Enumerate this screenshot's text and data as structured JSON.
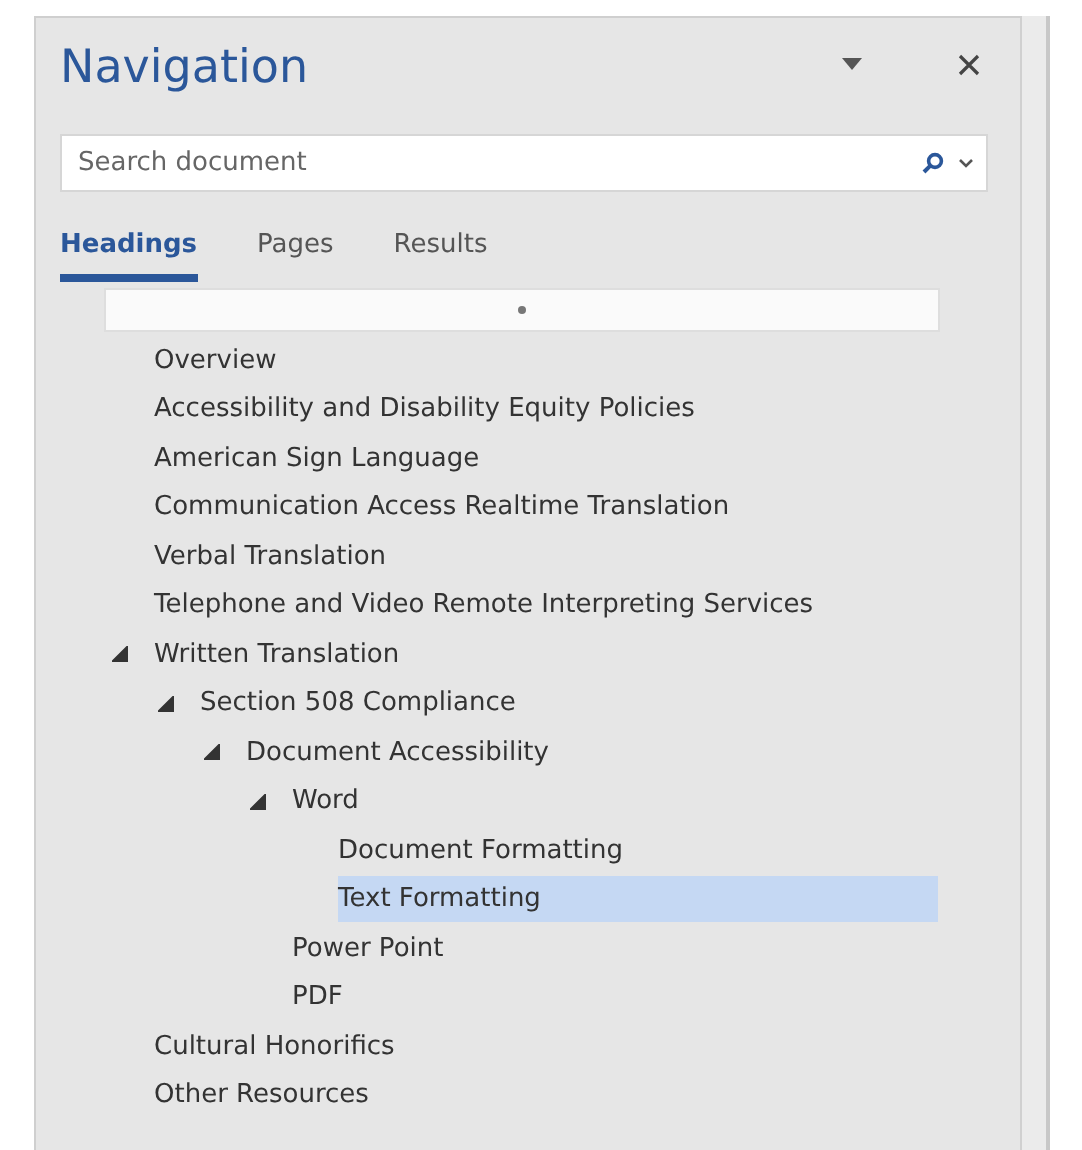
{
  "pane": {
    "title": "Navigation"
  },
  "search": {
    "placeholder": "Search document"
  },
  "tabs": [
    {
      "label": "Headings",
      "selected": true
    },
    {
      "label": "Pages",
      "selected": false
    },
    {
      "label": "Results",
      "selected": false
    }
  ],
  "tree": [
    {
      "label": "Overview",
      "selected": false
    },
    {
      "label": "Accessibility and Disability Equity Policies",
      "selected": false
    },
    {
      "label": "American Sign Language",
      "selected": false
    },
    {
      "label": "Communication Access Realtime Translation",
      "selected": false
    },
    {
      "label": "Verbal Translation",
      "selected": false
    },
    {
      "label": "Telephone and Video Remote Interpreting Services",
      "selected": false
    },
    {
      "label": "Written Translation",
      "selected": false,
      "expanded": true,
      "children": [
        {
          "label": "Section 508 Compliance",
          "selected": false,
          "expanded": true,
          "children": [
            {
              "label": "Document Accessibility",
              "selected": false,
              "expanded": true,
              "children": [
                {
                  "label": "Word",
                  "selected": false,
                  "expanded": true,
                  "children": [
                    {
                      "label": "Document Formatting",
                      "selected": false
                    },
                    {
                      "label": "Text Formatting",
                      "selected": true
                    }
                  ]
                },
                {
                  "label": "Power Point",
                  "selected": false
                },
                {
                  "label": "PDF",
                  "selected": false
                }
              ]
            }
          ]
        }
      ]
    },
    {
      "label": "Cultural Honorifics",
      "selected": false
    },
    {
      "label": "Other Resources",
      "selected": false
    }
  ]
}
